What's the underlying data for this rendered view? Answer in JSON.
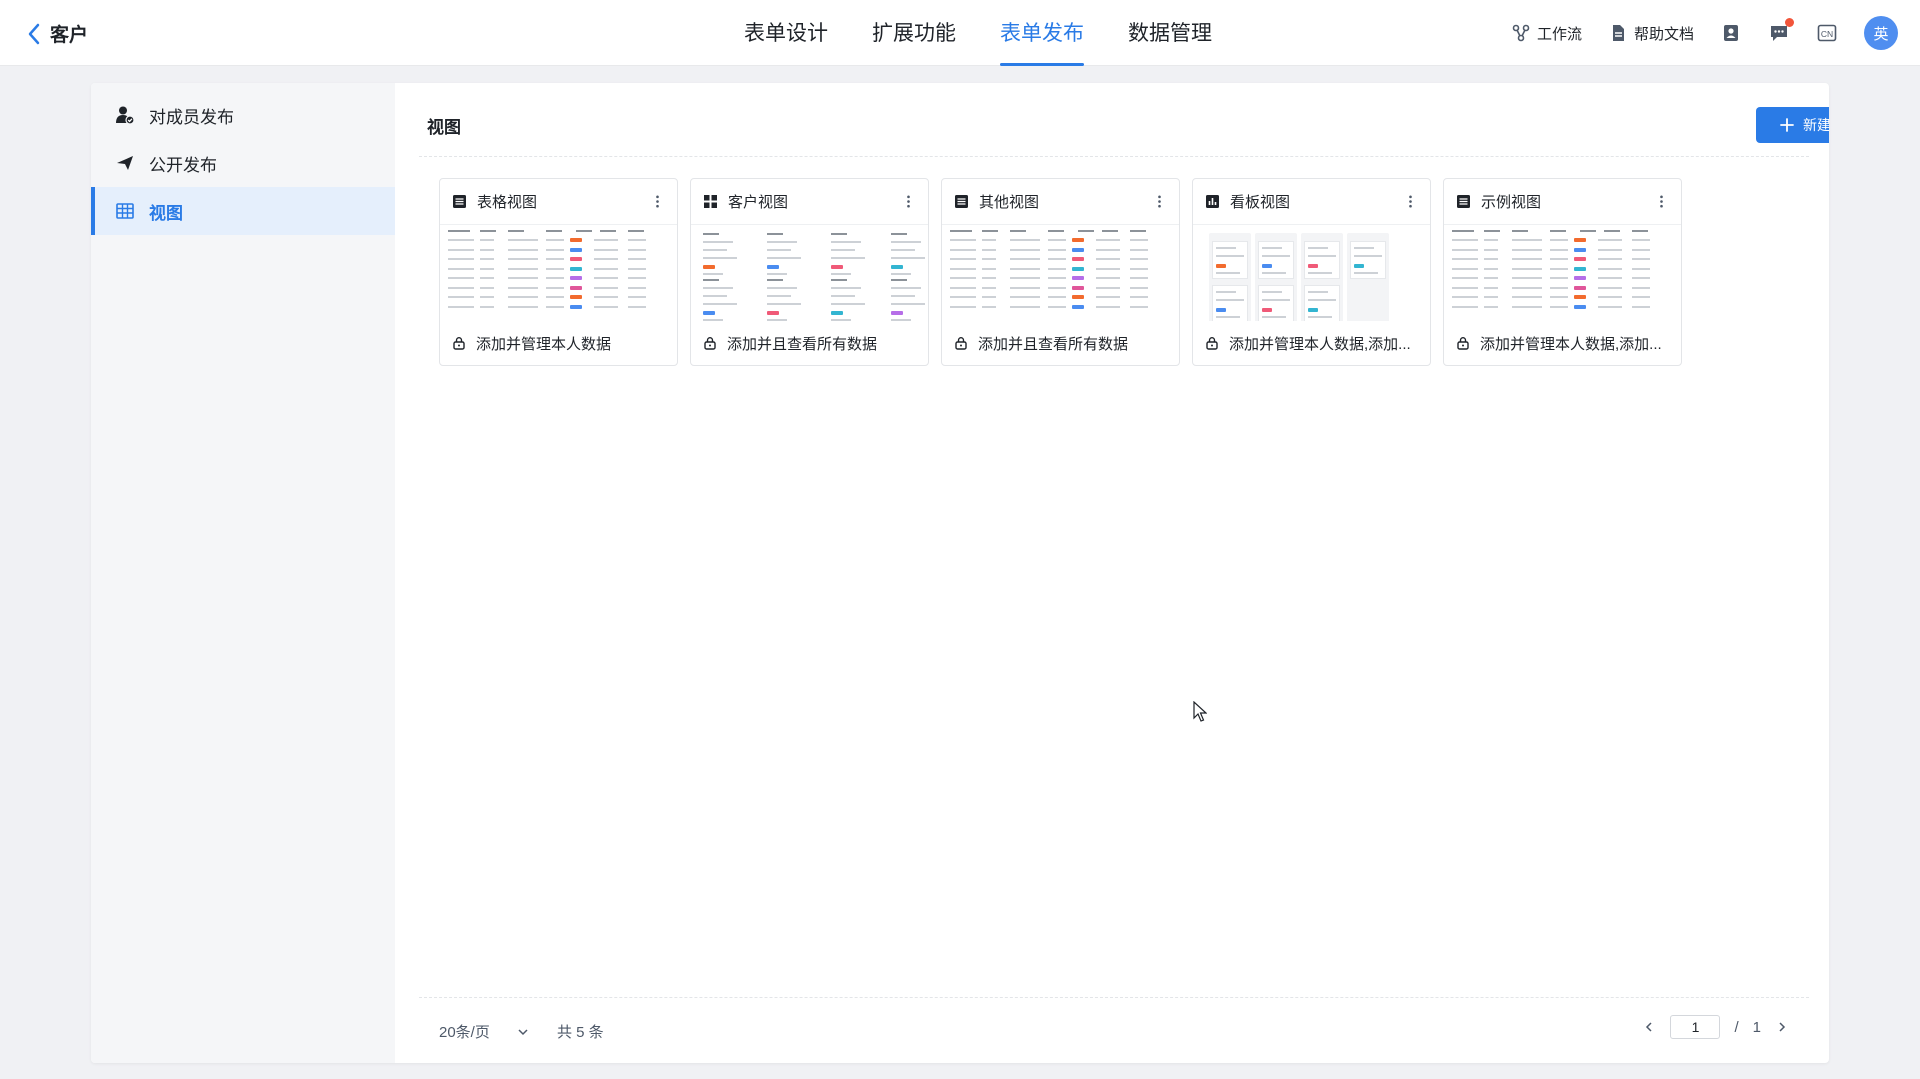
{
  "header": {
    "back_title": "客户",
    "tabs": [
      {
        "label": "表单设计",
        "active": false
      },
      {
        "label": "扩展功能",
        "active": false
      },
      {
        "label": "表单发布",
        "active": true
      },
      {
        "label": "数据管理",
        "active": false
      }
    ],
    "tools": {
      "workflow_label": "工作流",
      "help_label": "帮助文档",
      "lang": "CN",
      "avatar_text": "英"
    }
  },
  "sidebar": {
    "items": [
      {
        "label": "对成员发布",
        "icon": "member-publish-icon",
        "active": false
      },
      {
        "label": "公开发布",
        "icon": "paper-plane-icon",
        "active": false
      },
      {
        "label": "视图",
        "icon": "table-grid-icon",
        "active": true
      }
    ]
  },
  "main": {
    "title": "视图",
    "new_button_label": "新建视图",
    "cards": [
      {
        "title": "表格视图",
        "icon": "list-view-icon",
        "thumbnail": "table",
        "permission": "添加并管理本人数据"
      },
      {
        "title": "客户视图",
        "icon": "grid-view-icon",
        "thumbnail": "cards",
        "permission": "添加并且查看所有数据"
      },
      {
        "title": "其他视图",
        "icon": "list-view-icon",
        "thumbnail": "table",
        "permission": "添加并且查看所有数据"
      },
      {
        "title": "看板视图",
        "icon": "kanban-view-icon",
        "thumbnail": "kanban",
        "permission": "添加并管理本人数据,添加..."
      },
      {
        "title": "示例视图",
        "icon": "list-view-icon",
        "thumbnail": "table",
        "permission": "添加并管理本人数据,添加..."
      }
    ]
  },
  "pagination": {
    "page_size": "20条/页",
    "total": "共 5 条",
    "current_page": "1",
    "separator": "/",
    "total_pages": "1"
  },
  "colors": {
    "accent": "#2a7be6",
    "badge_dot": "#f2553a",
    "avatar_bg": "#4f8ef0"
  }
}
